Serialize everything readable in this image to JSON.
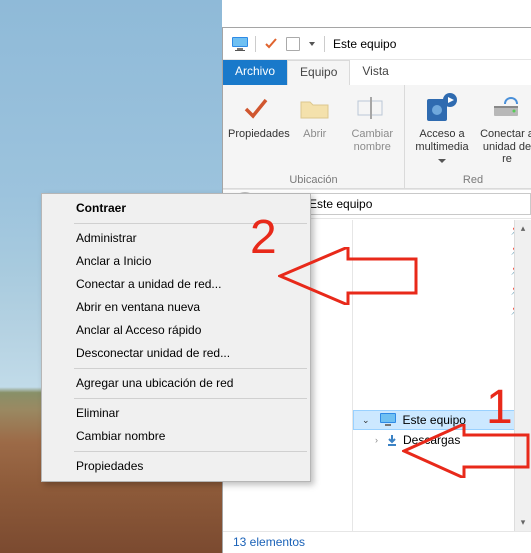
{
  "titlebar": {
    "title": "Este equipo"
  },
  "tabs": {
    "file": "Archivo",
    "equipo": "Equipo",
    "vista": "Vista"
  },
  "ribbon": {
    "group_ubicacion": "Ubicación",
    "group_red": "Red",
    "properties": "Propiedades",
    "open": "Abrir",
    "rename": "Cambiar\nnombre",
    "media": "Acceso a\nmultimedia",
    "mapdrive": "Conectar a\nunidad de re"
  },
  "address": {
    "root": "Este equipo"
  },
  "context": {
    "collapse": "Contraer",
    "manage": "Administrar",
    "pin_start": "Anclar a Inicio",
    "map_drive": "Conectar a unidad de red...",
    "open_new": "Abrir en ventana nueva",
    "pin_quick": "Anclar al Acceso rápido",
    "disconnect": "Desconectar unidad de red...",
    "add_location": "Agregar una ubicación de red",
    "delete": "Eliminar",
    "rename": "Cambiar nombre",
    "properties": "Propiedades"
  },
  "tree": {
    "this_pc": "Este equipo",
    "downloads": "Descargas"
  },
  "status": {
    "items": "13 elementos"
  },
  "annotations": {
    "one": "1",
    "two": "2"
  }
}
